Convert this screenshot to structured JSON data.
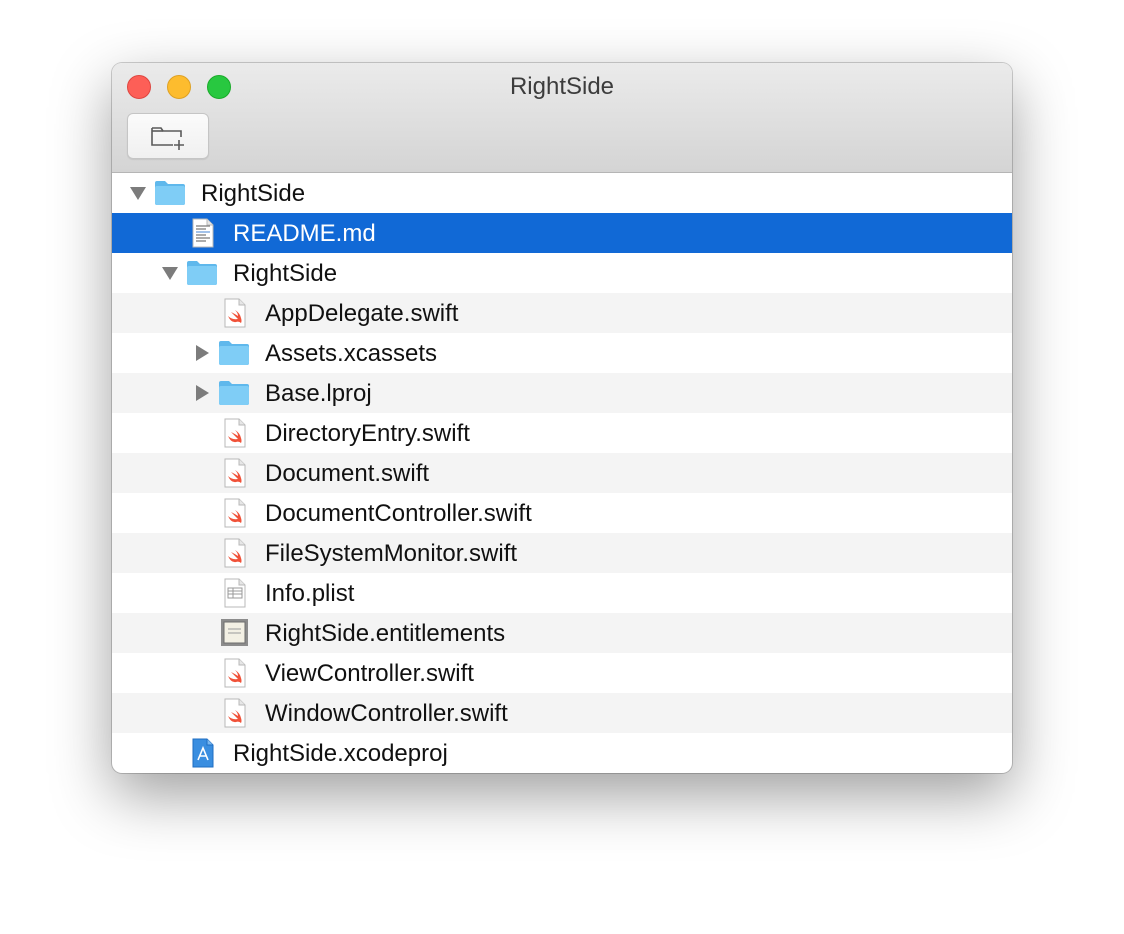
{
  "window": {
    "title": "RightSide"
  },
  "toolbar": {
    "new_folder_icon": "folder-plus-icon"
  },
  "colors": {
    "selection": "#1169d6",
    "folder": "#7fcdf6",
    "swift": "#f05138"
  },
  "outline": {
    "items": [
      {
        "label": "RightSide",
        "kind": "folder",
        "disclosure": "expanded"
      },
      {
        "label": "README.md",
        "kind": "text-file",
        "selected": true
      },
      {
        "label": "RightSide",
        "kind": "folder",
        "disclosure": "expanded"
      },
      {
        "label": "AppDelegate.swift",
        "kind": "swift-file"
      },
      {
        "label": "Assets.xcassets",
        "kind": "folder",
        "disclosure": "collapsed"
      },
      {
        "label": "Base.lproj",
        "kind": "folder",
        "disclosure": "collapsed"
      },
      {
        "label": "DirectoryEntry.swift",
        "kind": "swift-file"
      },
      {
        "label": "Document.swift",
        "kind": "swift-file"
      },
      {
        "label": "DocumentController.swift",
        "kind": "swift-file"
      },
      {
        "label": "FileSystemMonitor.swift",
        "kind": "swift-file"
      },
      {
        "label": "Info.plist",
        "kind": "plist-file"
      },
      {
        "label": "RightSide.entitlements",
        "kind": "entitlements-file"
      },
      {
        "label": "ViewController.swift",
        "kind": "swift-file"
      },
      {
        "label": "WindowController.swift",
        "kind": "swift-file"
      },
      {
        "label": "RightSide.xcodeproj",
        "kind": "xcodeproj-file"
      }
    ]
  }
}
